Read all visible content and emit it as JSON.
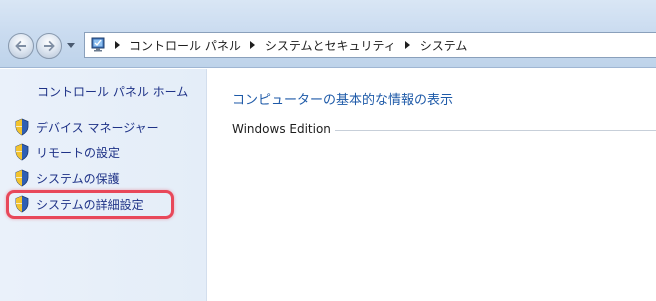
{
  "address_bar": {
    "breadcrumbs": [
      "コントロール パネル",
      "システムとセキュリティ",
      "システム"
    ],
    "icon": "control-panel-icon"
  },
  "navigation": {
    "back_icon": "back-arrow-icon",
    "forward_icon": "forward-arrow-icon",
    "history_icon": "chevron-down-icon"
  },
  "left_pane": {
    "home_link": "コントロール パネル ホーム",
    "tasks": [
      {
        "label": "デバイス マネージャー",
        "icon": "uac-shield-icon"
      },
      {
        "label": "リモートの設定",
        "icon": "uac-shield-icon"
      },
      {
        "label": "システムの保護",
        "icon": "uac-shield-icon"
      },
      {
        "label": "システムの詳細設定",
        "icon": "uac-shield-icon",
        "highlighted": true
      }
    ]
  },
  "main": {
    "title": "コンピューターの基本的な情報の表示",
    "section_heading": "Windows Edition"
  },
  "colors": {
    "link": "#1e3287",
    "title_link": "#1e5aa8",
    "highlight": "#e8485a"
  }
}
